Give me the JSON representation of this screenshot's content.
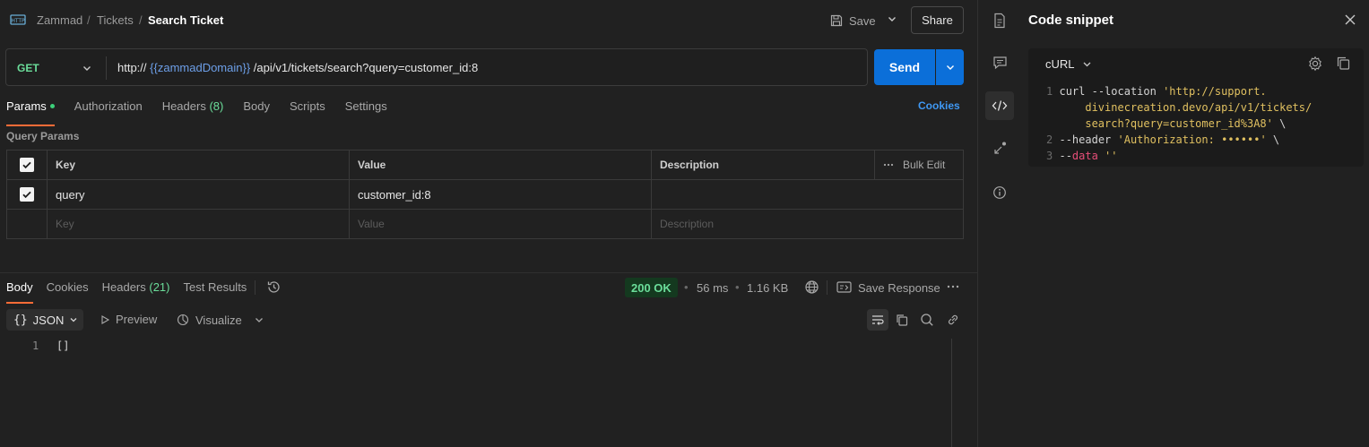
{
  "header": {
    "breadcrumb": [
      "Zammad",
      "Tickets",
      "Search Ticket"
    ],
    "save_label": "Save",
    "share_label": "Share"
  },
  "request": {
    "method": "GET",
    "url_prefix": "http://",
    "url_variable": "{{zammadDomain}}",
    "url_suffix": "/api/v1/tickets/search?query=customer_id:8",
    "send_label": "Send",
    "tabs": [
      {
        "label": "Params",
        "active": true,
        "dot": true
      },
      {
        "label": "Authorization"
      },
      {
        "label": "Headers",
        "count": "(8)"
      },
      {
        "label": "Body"
      },
      {
        "label": "Scripts"
      },
      {
        "label": "Settings"
      }
    ],
    "cookies_label": "Cookies"
  },
  "params": {
    "title": "Query Params",
    "columns": {
      "key": "Key",
      "value": "Value",
      "description": "Description",
      "bulk_edit": "Bulk Edit"
    },
    "rows": [
      {
        "checked": true,
        "key": "query",
        "value": "customer_id:8",
        "description": ""
      }
    ],
    "placeholders": {
      "key": "Key",
      "value": "Value",
      "description": "Description"
    }
  },
  "response": {
    "tabs": [
      {
        "label": "Body",
        "active": true
      },
      {
        "label": "Cookies"
      },
      {
        "label": "Headers",
        "count": "(21)"
      },
      {
        "label": "Test Results"
      }
    ],
    "status": "200 OK",
    "time": "56 ms",
    "size": "1.16 KB",
    "save_response_label": "Save Response",
    "format": "JSON",
    "preview_label": "Preview",
    "visualize_label": "Visualize",
    "lines": [
      {
        "n": "1",
        "text": "[]"
      }
    ]
  },
  "snippet": {
    "title": "Code snippet",
    "language": "cURL",
    "code_lines": [
      {
        "n": "1",
        "a": "curl --location ",
        "s": "'http://support.",
        "b": ""
      },
      {
        "n": "",
        "a": "     ",
        "s": "divinecreation.devo/api/v1/tickets/",
        "b": ""
      },
      {
        "n": "",
        "a": "     ",
        "s": "search?query=customer_id%3A8'",
        "b": " \\"
      },
      {
        "n": "2",
        "a": "--header ",
        "s": "'Authorization: ••••••'",
        "b": " \\"
      },
      {
        "n": "3",
        "a": "--",
        "kw": "data",
        "s": " ''",
        "b": ""
      }
    ]
  },
  "colors": {
    "accent": "#ff6c37",
    "send": "#0b6fd9",
    "success": "#6bdd9a",
    "link": "#3f98f3"
  }
}
